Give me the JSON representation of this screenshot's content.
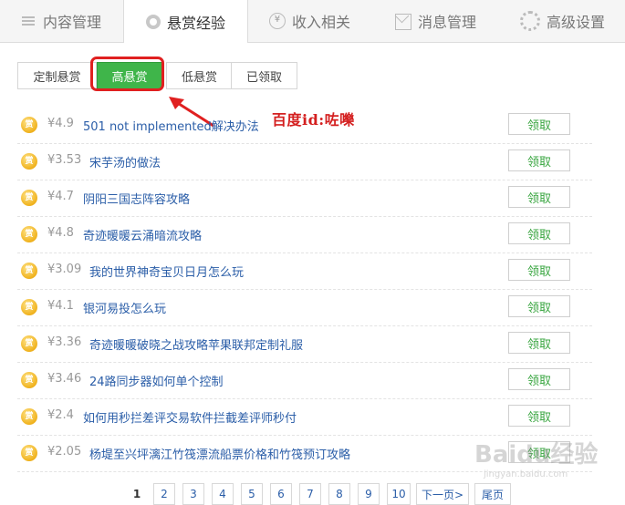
{
  "top_tabs": [
    {
      "label": "内容管理",
      "icon": "list-icon"
    },
    {
      "label": "悬赏经验",
      "icon": "medal-icon",
      "active": true
    },
    {
      "label": "收入相关",
      "icon": "yen-icon"
    },
    {
      "label": "消息管理",
      "icon": "mail-icon"
    },
    {
      "label": "高级设置",
      "icon": "gear-icon"
    }
  ],
  "filters": [
    {
      "label": "定制悬赏"
    },
    {
      "label": "高悬赏",
      "active": true
    },
    {
      "label": "低悬赏"
    },
    {
      "label": "已领取"
    }
  ],
  "annotation": "百度id:咗嚛",
  "coin_glyph": "赏",
  "claim_label": "领取",
  "rewards": [
    {
      "price": "¥4.9",
      "title": "501 not implemented解决办法"
    },
    {
      "price": "¥3.53",
      "title": "宋芋汤的做法"
    },
    {
      "price": "¥4.7",
      "title": "阴阳三国志阵容攻略"
    },
    {
      "price": "¥4.8",
      "title": "奇迹暖暖云涌暗流攻略"
    },
    {
      "price": "¥3.09",
      "title": "我的世界神奇宝贝日月怎么玩"
    },
    {
      "price": "¥4.1",
      "title": "银河易投怎么玩"
    },
    {
      "price": "¥3.36",
      "title": "奇迹暖暖破晓之战攻略苹果联邦定制礼服"
    },
    {
      "price": "¥3.46",
      "title": "24路同步器如何单个控制"
    },
    {
      "price": "¥2.4",
      "title": "如何用秒拦差评交易软件拦截差评师秒付"
    },
    {
      "price": "¥2.05",
      "title": "杨堤至兴坪漓江竹筏漂流船票价格和竹筏预订攻略"
    }
  ],
  "pagination": {
    "pages": [
      "1",
      "2",
      "3",
      "4",
      "5",
      "6",
      "7",
      "8",
      "9",
      "10"
    ],
    "current": "1",
    "next_label": "下一页>",
    "last_label": "尾页"
  },
  "watermark": {
    "logo": "Baidu经验",
    "sub": "jingyan.baidu.com"
  },
  "colors": {
    "accent_green": "#3fb54a",
    "highlight_red": "#e02020",
    "link_blue": "#2b5ea8",
    "coin_gold": "#f0b21d"
  }
}
